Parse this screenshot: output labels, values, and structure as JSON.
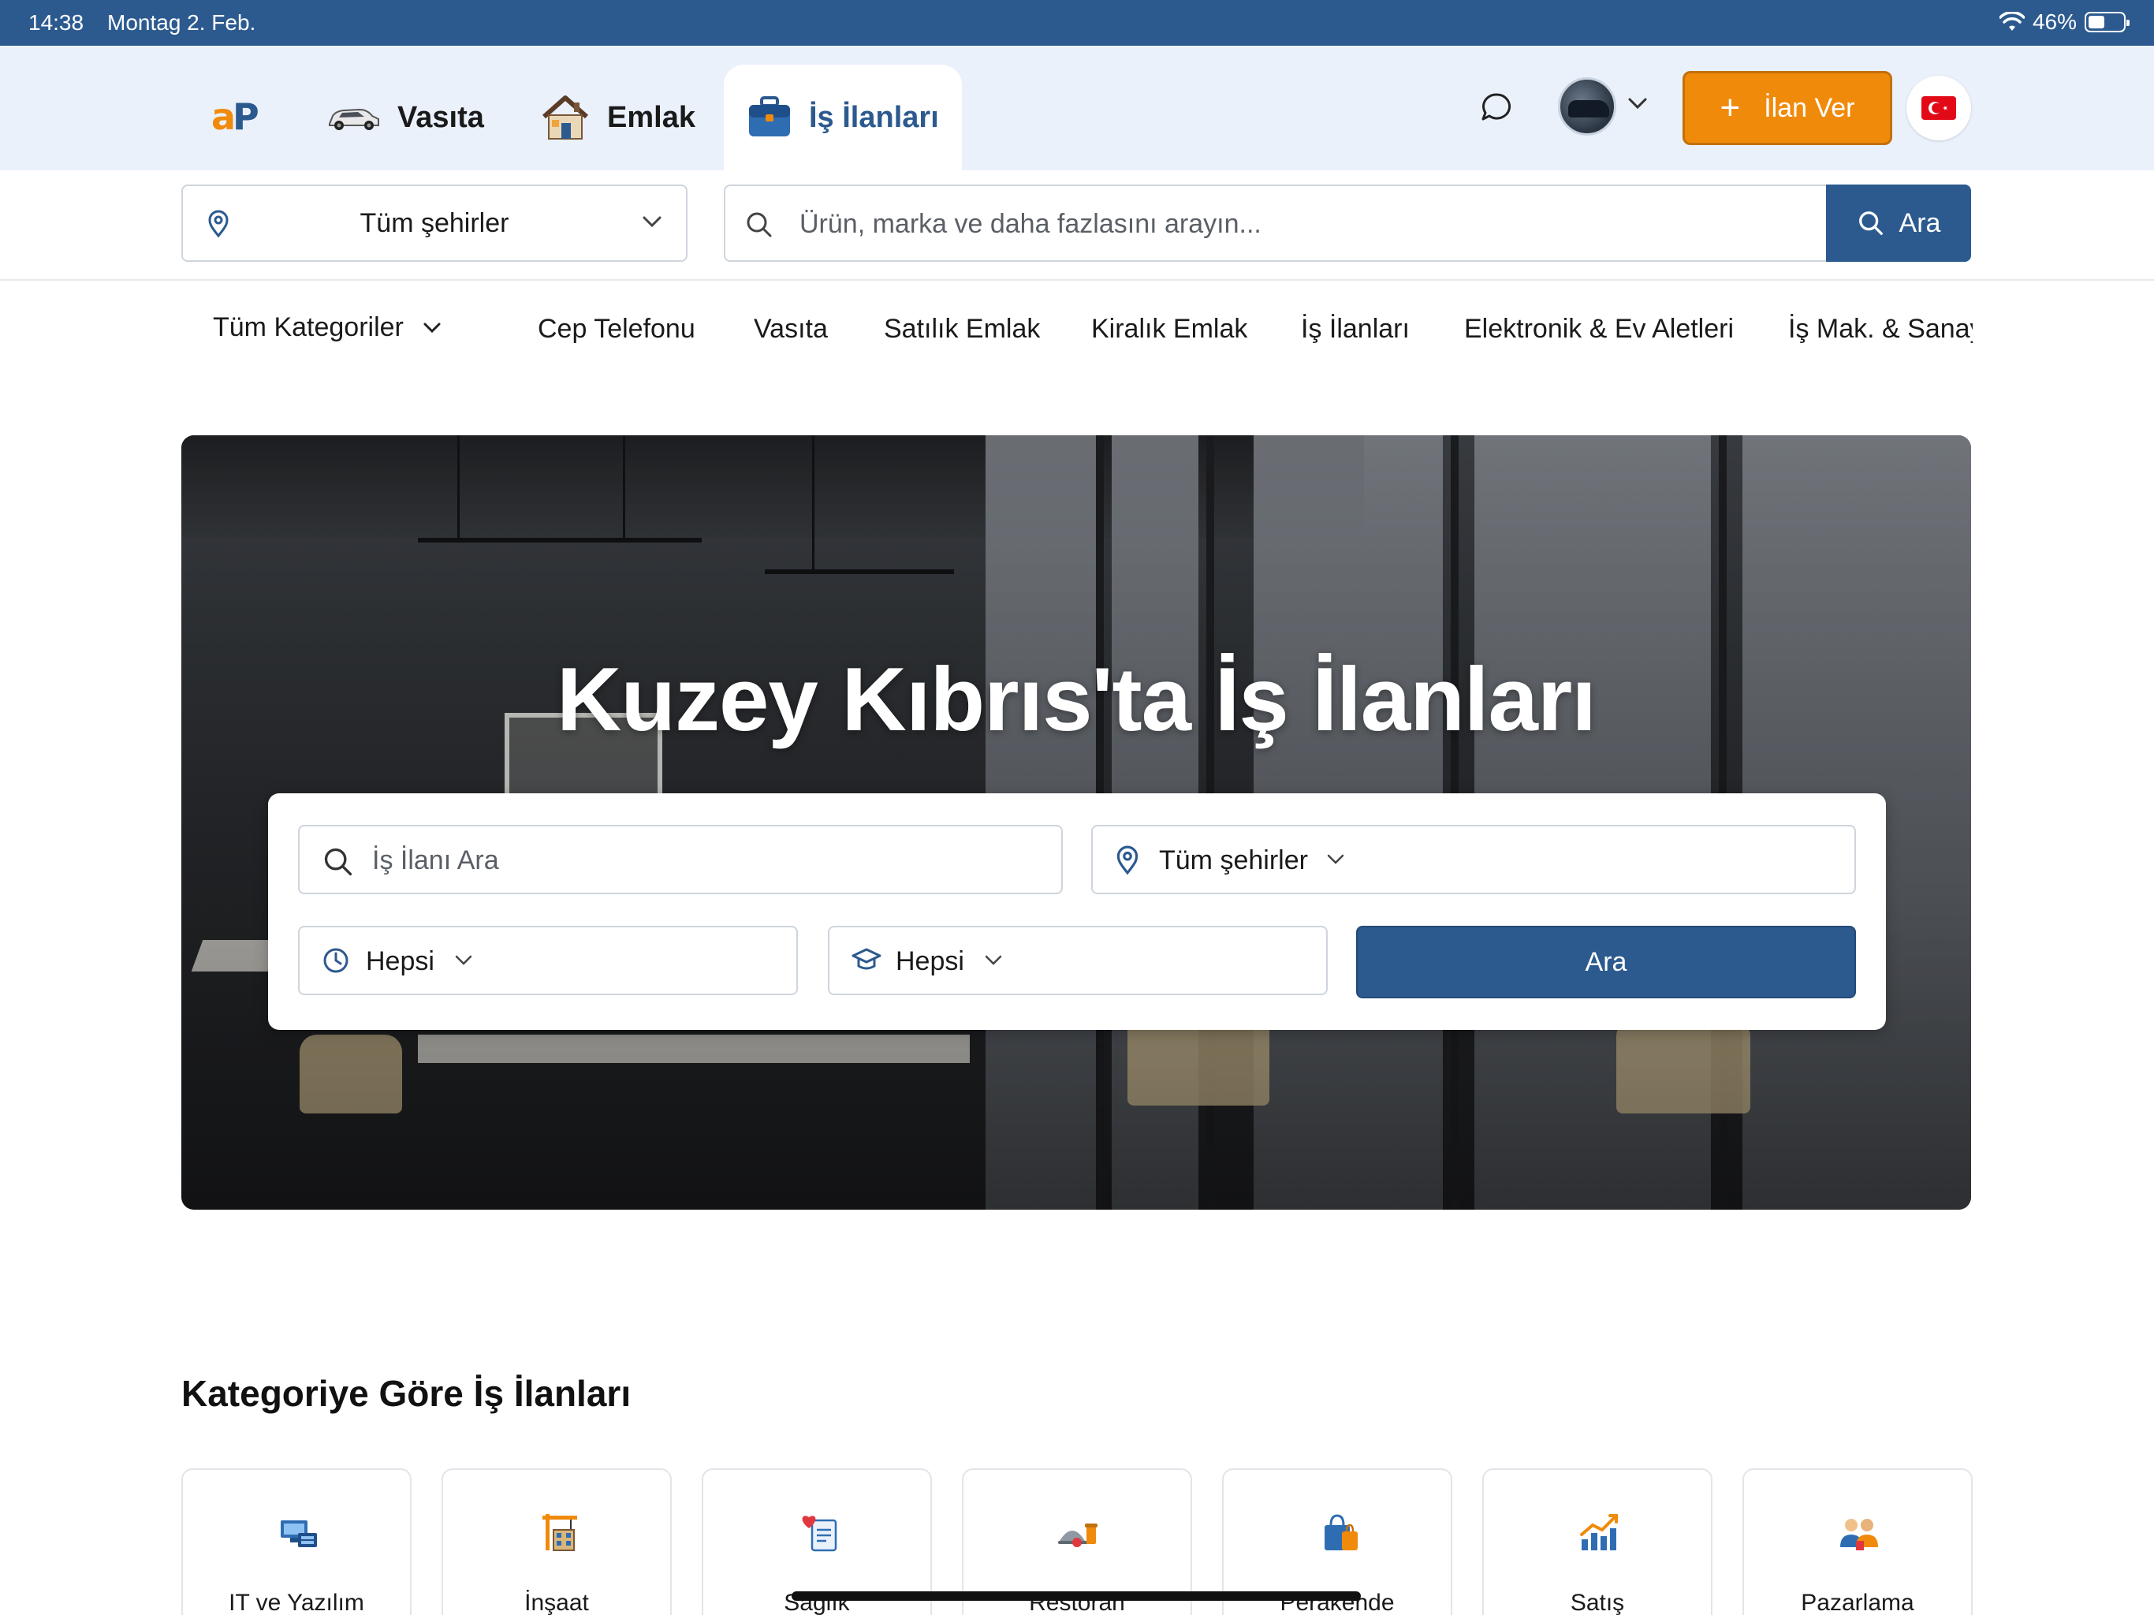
{
  "status_bar": {
    "time": "14:38",
    "date": "Montag 2. Feb.",
    "battery": "46%"
  },
  "nav": {
    "logo_a": "a",
    "logo_p": "P",
    "tabs": [
      {
        "label": "Vasıta",
        "active": false
      },
      {
        "label": "Emlak",
        "active": false
      },
      {
        "label": "İş İlanları",
        "active": true
      }
    ],
    "post_button": "İlan Ver"
  },
  "search": {
    "city": "Tüm şehirler",
    "placeholder": "Ürün, marka ve daha fazlasını arayın...",
    "button": "Ara"
  },
  "categories_bar": {
    "all": "Tüm Kategoriler",
    "items": [
      "Cep Telefonu",
      "Vasıta",
      "Satılık Emlak",
      "Kiralık Emlak",
      "İş İlanları",
      "Elektronik & Ev Aletleri",
      "İş Mak. & Sanayi"
    ]
  },
  "hero": {
    "title": "Kuzey Kıbrıs'ta İş İlanları",
    "job_search_placeholder": "İş İlanı Ara",
    "city": "Tüm şehirler",
    "time_filter": "Hepsi",
    "education_filter": "Hepsi",
    "search_button": "Ara"
  },
  "section": {
    "title": "Kategoriye Göre İş İlanları",
    "cards": [
      {
        "label": "IT ve Yazılım",
        "icon": "computer-icon"
      },
      {
        "label": "İnşaat",
        "icon": "construction-icon"
      },
      {
        "label": "Sağlık",
        "icon": "health-icon"
      },
      {
        "label": "Restoran",
        "icon": "restaurant-icon"
      },
      {
        "label": "Perakende",
        "icon": "shopping-bag-icon"
      },
      {
        "label": "Satış",
        "icon": "sales-chart-icon"
      },
      {
        "label": "Pazarlama",
        "icon": "marketing-people-icon"
      }
    ]
  },
  "colors": {
    "brand_blue": "#2c5a8f",
    "brand_orange": "#f08a0b",
    "nav_bg": "#eaf1fb"
  }
}
